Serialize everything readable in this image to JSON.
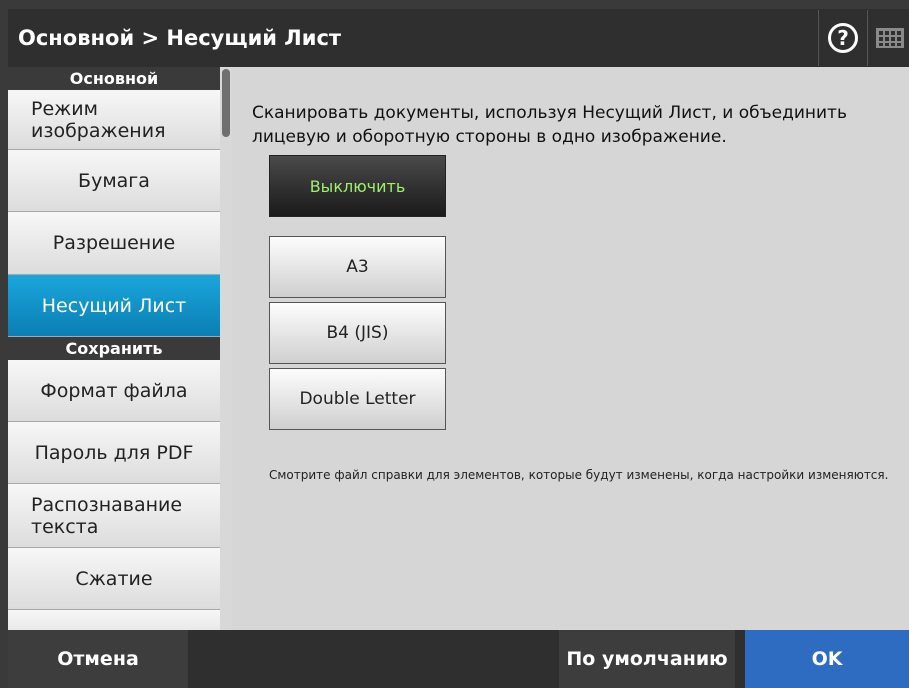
{
  "header": {
    "title": "Основной > Несущий Лист",
    "help_label": "?"
  },
  "sidebar": {
    "section1": "Основной",
    "section2": "Сохранить",
    "items": [
      {
        "label": "Режим изображения"
      },
      {
        "label": "Бумага"
      },
      {
        "label": "Разрешение"
      },
      {
        "label": "Несущий Лист"
      },
      {
        "label": "Формат файла"
      },
      {
        "label": "Пароль для PDF"
      },
      {
        "label": "Распознавание текста"
      },
      {
        "label": "Сжатие"
      }
    ],
    "active_item": "Несущий Лист"
  },
  "main": {
    "description": "Сканировать документы, используя Несущий Лист, и объединить лицевую и оборотную стороны в одно изображение.",
    "options": [
      {
        "label": "Выключить",
        "selected": true
      },
      {
        "label": "A3",
        "selected": false
      },
      {
        "label": "B4 (JIS)",
        "selected": false
      },
      {
        "label": "Double Letter",
        "selected": false
      }
    ],
    "note": "Смотрите файл справки для элементов, которые будут изменены, когда настройки изменяются."
  },
  "footer": {
    "cancel_label": "Отмена",
    "default_label": "По умолчанию",
    "ok_label": "OK"
  },
  "colors": {
    "accent_active": "#0b8fcb",
    "ok_button": "#2d6cc0",
    "selected_text": "#9df06e"
  }
}
